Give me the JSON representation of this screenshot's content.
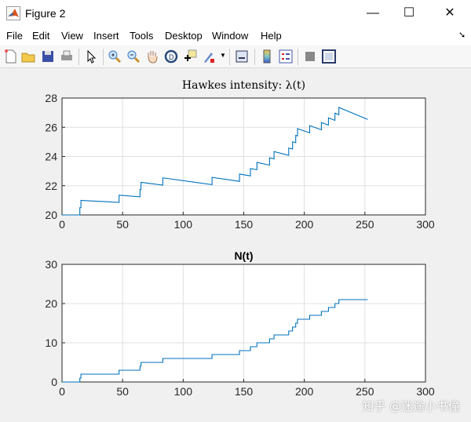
{
  "window": {
    "title": "Figure 2",
    "minimize": "—",
    "maximize": "☐",
    "close": "✕"
  },
  "menu": [
    "File",
    "Edit",
    "View",
    "Insert",
    "Tools",
    "Desktop",
    "Window",
    "Help"
  ],
  "toolbar_icons": [
    "new-figure-icon",
    "open-file-icon",
    "save-icon",
    "print-icon",
    "pointer-icon",
    "zoom-in-icon",
    "zoom-out-icon",
    "pan-icon",
    "rotate-3d-icon",
    "data-cursor-icon",
    "brush-icon",
    "link-plot-icon",
    "colorbar-icon",
    "legend-icon",
    "hide-plot-tools-icon",
    "show-plot-tools-icon"
  ],
  "watermark": "知乎 @迷途小书僮",
  "chart_data": [
    {
      "type": "line",
      "title": "Hawkes intensity: λ(t)",
      "xlabel": "",
      "ylabel": "",
      "xlim": [
        0,
        300
      ],
      "ylim": [
        20,
        28
      ],
      "xticks": [
        "0",
        "50",
        "100",
        "150",
        "200",
        "250",
        "300"
      ],
      "yticks": [
        "20",
        "22",
        "24",
        "26",
        "28"
      ],
      "grid": true,
      "color": "#0072bd",
      "series": [
        {
          "name": "λ(t)",
          "base": 20,
          "jump": 0.5,
          "decay": 0.005,
          "t_end": 252.3
        }
      ]
    },
    {
      "type": "line",
      "step": true,
      "title": "N(t)",
      "xlabel": "",
      "ylabel": "",
      "xlim": [
        0,
        300
      ],
      "ylim": [
        0,
        30
      ],
      "xticks": [
        "0",
        "50",
        "100",
        "150",
        "200",
        "250",
        "300"
      ],
      "yticks": [
        "0",
        "10",
        "20",
        "30"
      ],
      "grid": true,
      "color": "#0072bd",
      "series": [
        {
          "name": "N(t)",
          "event_times": [
            14.7,
            15.6,
            47.1,
            64.4,
            65.2,
            83.2,
            123.8,
            146.5,
            155.5,
            160.9,
            171.3,
            175.0,
            187.1,
            190.3,
            192.9,
            194.4,
            204.4,
            214.1,
            219.9,
            225.3,
            228.5
          ],
          "t_end": 252.3
        }
      ]
    }
  ]
}
